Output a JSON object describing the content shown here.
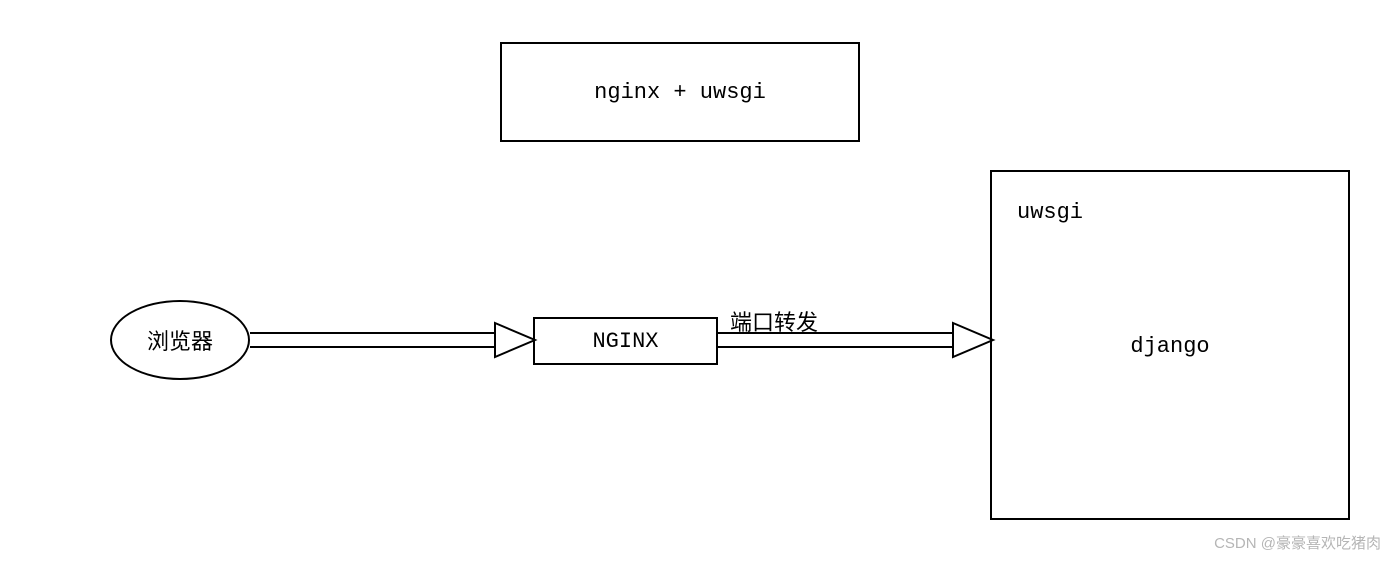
{
  "title": "nginx + uwsgi",
  "nodes": {
    "browser": "浏览器",
    "nginx": "NGINX",
    "uwsgi": "uwsgi",
    "django": "django"
  },
  "edges": {
    "port_forward_label": "端口转发"
  },
  "watermark": "CSDN @豪豪喜欢吃猪肉"
}
